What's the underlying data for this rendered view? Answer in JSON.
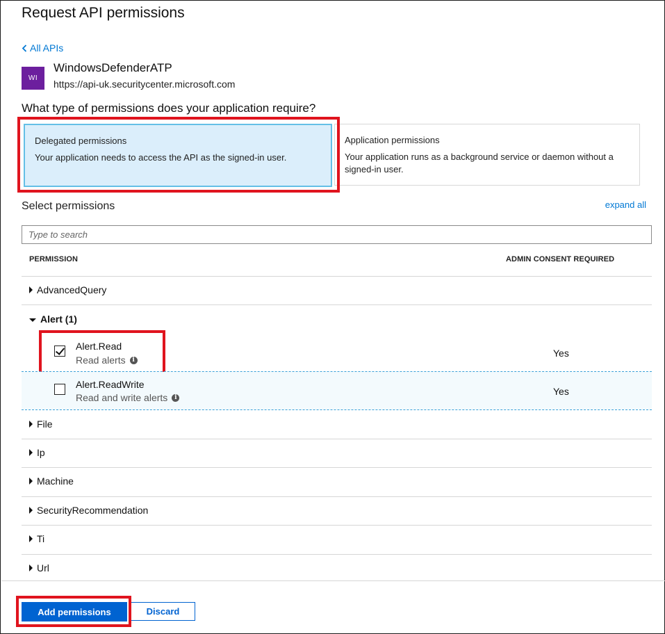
{
  "header": {
    "title": "Request API permissions"
  },
  "back_link": {
    "label": "All APIs"
  },
  "api": {
    "logo_text": "WI",
    "name": "WindowsDefenderATP",
    "url": "https://api-uk.securitycenter.microsoft.com",
    "logo_color": "#6c1f9e"
  },
  "question": "What type of permissions does your application require?",
  "permission_types": {
    "delegated": {
      "title": "Delegated permissions",
      "description": "Your application needs to access the API as the signed-in user.",
      "selected": true
    },
    "application": {
      "title": "Application permissions",
      "description": "Your application runs as a background service or daemon without a signed-in user.",
      "selected": false
    }
  },
  "select_permissions": {
    "label": "Select permissions",
    "expand_all": "expand all",
    "search_placeholder": "Type to search"
  },
  "table": {
    "col_permission": "PERMISSION",
    "col_admin": "ADMIN CONSENT REQUIRED"
  },
  "groups": [
    {
      "label": "AdvancedQuery",
      "expanded": false
    },
    {
      "label": "Alert (1)",
      "expanded": true,
      "items": [
        {
          "name": "Alert.Read",
          "description": "Read alerts",
          "checked": true,
          "admin": "Yes"
        },
        {
          "name": "Alert.ReadWrite",
          "description": "Read and write alerts",
          "checked": false,
          "admin": "Yes"
        }
      ]
    },
    {
      "label": "File",
      "expanded": false
    },
    {
      "label": "Ip",
      "expanded": false
    },
    {
      "label": "Machine",
      "expanded": false
    },
    {
      "label": "SecurityRecommendation",
      "expanded": false
    },
    {
      "label": "Ti",
      "expanded": false
    },
    {
      "label": "Url",
      "expanded": false
    }
  ],
  "footer": {
    "add_label": "Add permissions",
    "discard_label": "Discard"
  },
  "colors": {
    "accent": "#0063d1",
    "link": "#0078d4",
    "highlight": "#e0141e",
    "selected_card_bg": "#dbeefb"
  }
}
